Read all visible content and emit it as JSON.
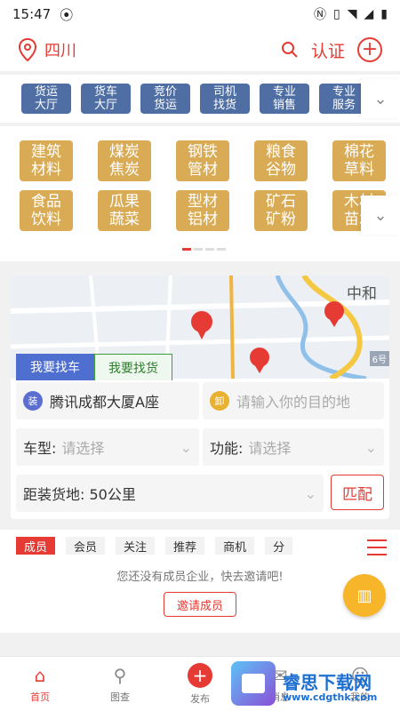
{
  "status": {
    "time": "15:47"
  },
  "header": {
    "location": "四川",
    "certify": "认证"
  },
  "categories": [
    "货运\n大厅",
    "货车\n大厅",
    "竞价\n货运",
    "司机\n找货",
    "专业\n销售",
    "专业\n服务"
  ],
  "goods": [
    "建筑\n材料",
    "煤炭\n焦炭",
    "钢铁\n管材",
    "粮食\n谷物",
    "棉花\n草料",
    "食品\n饮料",
    "瓜果\n蔬菜",
    "型材\n铝材",
    "矿石\n矿粉",
    "木材\n苗木"
  ],
  "map": {
    "label": "中和",
    "label2": "6号"
  },
  "tabs": {
    "find_truck": "我要找车",
    "find_goods": "我要找货"
  },
  "form": {
    "load_badge": "装",
    "origin": "腾讯成都大厦A座",
    "unload_badge": "卸",
    "dest_placeholder": "请输入你的目的地",
    "truck_type_label": "车型:",
    "truck_type_placeholder": "请选择",
    "function_label": "功能:",
    "function_placeholder": "请选择",
    "distance": "距装货地: 50公里",
    "match": "匹配"
  },
  "member": {
    "tabs": [
      "成员",
      "会员",
      "关注",
      "推荐",
      "商机",
      "分"
    ],
    "empty": "您还没有成员企业，快去邀请吧!",
    "invite": "邀请成员"
  },
  "bottom_nav": [
    "首页",
    "图查",
    "发布",
    "消息",
    "我的"
  ],
  "watermark": {
    "name": "睿思下载网",
    "url": "www.cdgthk.com"
  },
  "colors": {
    "brand": "#e53b34",
    "category": "#4f6fa4",
    "goods": "#d9ab55"
  }
}
